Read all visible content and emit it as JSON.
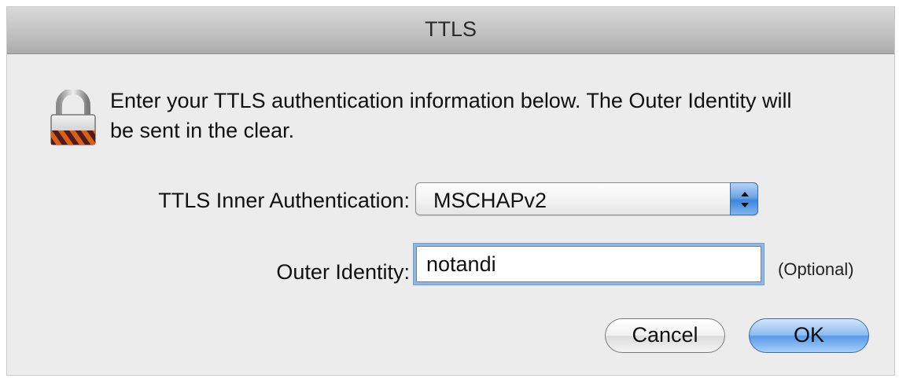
{
  "window": {
    "title": "TTLS"
  },
  "message": {
    "text": "Enter your TTLS authentication information below. The Outer Identity will be sent in the clear.",
    "icon": "lock-icon"
  },
  "inner_auth": {
    "label": "TTLS Inner Authentication:",
    "selected": "MSCHAPv2"
  },
  "outer_identity": {
    "label": "Outer Identity:",
    "value": "notandi",
    "hint": "(Optional)"
  },
  "buttons": {
    "cancel": "Cancel",
    "ok": "OK"
  },
  "colors": {
    "accent": "#5a9ae8",
    "window_bg": "#ececec"
  }
}
